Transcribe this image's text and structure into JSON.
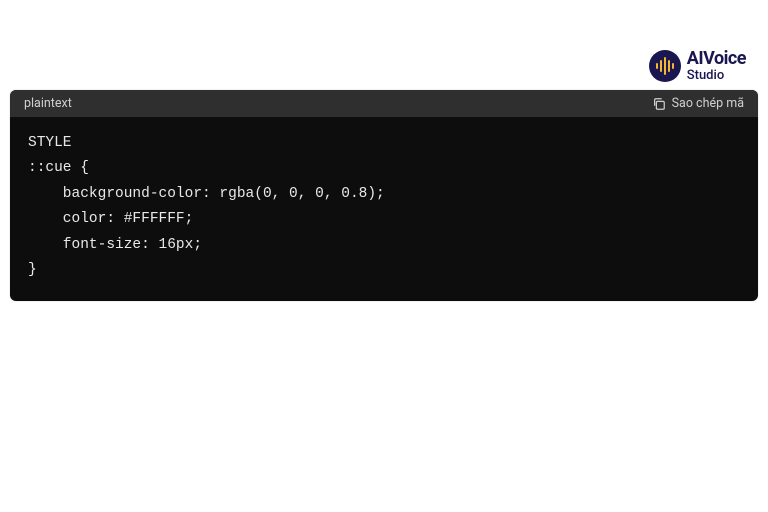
{
  "logo": {
    "brand": "AIVoice",
    "sub": "Studio"
  },
  "code_block": {
    "language": "plaintext",
    "copy_label": "Sao chép mã",
    "lines": [
      "STYLE",
      "::cue {",
      "    background-color: rgba(0, 0, 0, 0.8);",
      "    color: #FFFFFF;",
      "    font-size: 16px;",
      "}"
    ]
  }
}
